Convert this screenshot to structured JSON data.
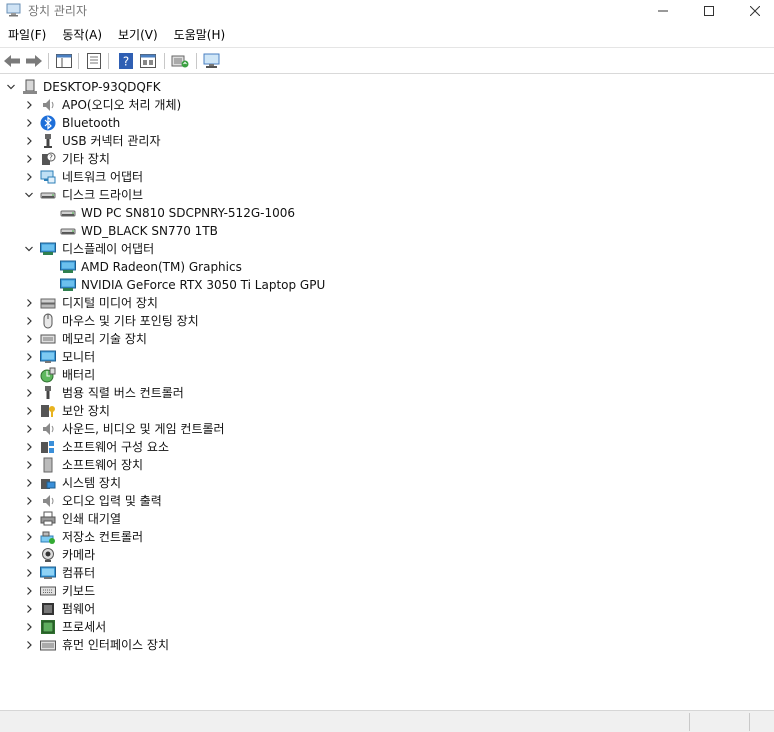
{
  "window": {
    "title": "장치 관리자"
  },
  "menu": [
    {
      "label": "파일(F)"
    },
    {
      "label": "동작(A)"
    },
    {
      "label": "보기(V)"
    },
    {
      "label": "도움말(H)"
    }
  ],
  "toolbar": {
    "buttons": [
      "back-icon",
      "forward-icon",
      "show-hide-tree-icon",
      "properties-icon",
      "help-icon",
      "view-icon",
      "update-driver-icon",
      "scan-hardware-icon"
    ]
  },
  "tree": {
    "root": "DESKTOP-93QDQFK",
    "categories": [
      {
        "label": "APO(오디오 처리 개체)",
        "icon": "speaker-icon"
      },
      {
        "label": "Bluetooth",
        "icon": "bluetooth-icon"
      },
      {
        "label": "USB 커넥터 관리자",
        "icon": "usb-connector-icon"
      },
      {
        "label": "기타 장치",
        "icon": "unknown-device-icon"
      },
      {
        "label": "네트워크 어댑터",
        "icon": "network-adapter-icon"
      },
      {
        "label": "디스크 드라이브",
        "icon": "disk-drive-icon",
        "expanded": true,
        "children": [
          {
            "label": "WD PC SN810 SDCPNRY-512G-1006",
            "icon": "disk-drive-icon"
          },
          {
            "label": "WD_BLACK SN770 1TB",
            "icon": "disk-drive-icon"
          }
        ]
      },
      {
        "label": "디스플레이 어댑터",
        "icon": "display-adapter-icon",
        "expanded": true,
        "children": [
          {
            "label": "AMD Radeon(TM) Graphics",
            "icon": "display-adapter-icon"
          },
          {
            "label": "NVIDIA GeForce RTX 3050 Ti Laptop GPU",
            "icon": "display-adapter-icon"
          }
        ]
      },
      {
        "label": "디지털 미디어 장치",
        "icon": "media-device-icon"
      },
      {
        "label": "마우스 및 기타 포인팅 장치",
        "icon": "mouse-icon"
      },
      {
        "label": "메모리 기술 장치",
        "icon": "memory-icon"
      },
      {
        "label": "모니터",
        "icon": "monitor-icon"
      },
      {
        "label": "배터리",
        "icon": "battery-icon"
      },
      {
        "label": "범용 직렬 버스 컨트롤러",
        "icon": "usb-icon"
      },
      {
        "label": "보안 장치",
        "icon": "security-key-icon"
      },
      {
        "label": "사운드, 비디오 및 게임 컨트롤러",
        "icon": "speaker-icon"
      },
      {
        "label": "소프트웨어 구성 요소",
        "icon": "software-component-icon"
      },
      {
        "label": "소프트웨어 장치",
        "icon": "software-device-icon"
      },
      {
        "label": "시스템 장치",
        "icon": "system-device-icon"
      },
      {
        "label": "오디오 입력 및 출력",
        "icon": "speaker-icon"
      },
      {
        "label": "인쇄 대기열",
        "icon": "printer-icon"
      },
      {
        "label": "저장소 컨트롤러",
        "icon": "storage-controller-icon"
      },
      {
        "label": "카메라",
        "icon": "camera-icon"
      },
      {
        "label": "컴퓨터",
        "icon": "computer-icon"
      },
      {
        "label": "키보드",
        "icon": "keyboard-icon"
      },
      {
        "label": "펌웨어",
        "icon": "firmware-icon"
      },
      {
        "label": "프로세서",
        "icon": "processor-icon"
      },
      {
        "label": "휴먼 인터페이스 장치",
        "icon": "hid-icon"
      }
    ]
  }
}
